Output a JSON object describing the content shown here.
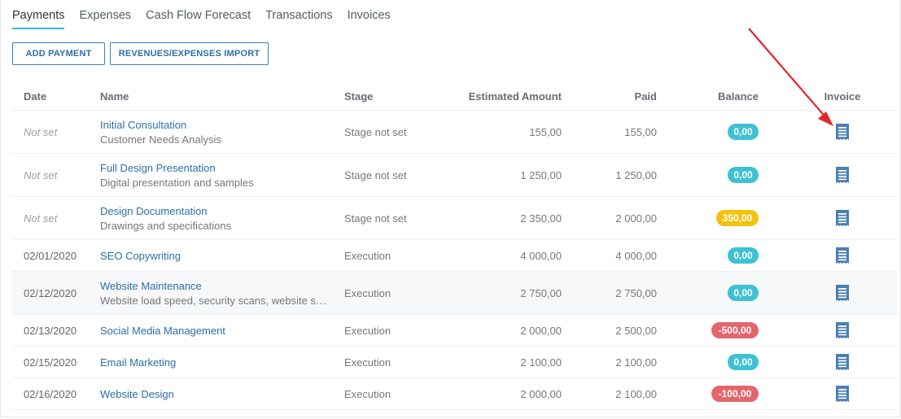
{
  "tabs": [
    {
      "label": "Payments",
      "active": true
    },
    {
      "label": "Expenses",
      "active": false
    },
    {
      "label": "Cash Flow Forecast",
      "active": false
    },
    {
      "label": "Transactions",
      "active": false
    },
    {
      "label": "Invoices",
      "active": false
    }
  ],
  "actions": {
    "add_payment": "ADD PAYMENT",
    "import": "REVENUES/EXPENSES IMPORT"
  },
  "table": {
    "headers": {
      "date": "Date",
      "name": "Name",
      "stage": "Stage",
      "estimated": "Estimated Amount",
      "paid": "Paid",
      "balance": "Balance",
      "invoice": "Invoice"
    },
    "rows": [
      {
        "date": "Not set",
        "name": "Initial Consultation",
        "desc": "Customer Needs Analysis",
        "stage": "Stage not set",
        "estimated": "155,00",
        "paid": "155,00",
        "balance": "0,00",
        "balance_color": "teal"
      },
      {
        "date": "Not set",
        "name": "Full Design Presentation",
        "desc": "Digital presentation and samples",
        "stage": "Stage not set",
        "estimated": "1 250,00",
        "paid": "1 250,00",
        "balance": "0,00",
        "balance_color": "teal"
      },
      {
        "date": "Not set",
        "name": "Design Documentation",
        "desc": "Drawings and specifications",
        "stage": "Stage not set",
        "estimated": "2 350,00",
        "paid": "2 000,00",
        "balance": "350,00",
        "balance_color": "yellow"
      },
      {
        "date": "02/01/2020",
        "name": "SEO Copywriting",
        "desc": "",
        "stage": "Execution",
        "estimated": "4 000,00",
        "paid": "4 000,00",
        "balance": "0,00",
        "balance_color": "teal"
      },
      {
        "date": "02/12/2020",
        "name": "Website Maintenance",
        "desc": "Website load speed, security scans, website s…",
        "stage": "Execution",
        "estimated": "2 750,00",
        "paid": "2 750,00",
        "balance": "0,00",
        "balance_color": "teal"
      },
      {
        "date": "02/13/2020",
        "name": "Social Media Management",
        "desc": "",
        "stage": "Execution",
        "estimated": "2 000,00",
        "paid": "2 500,00",
        "balance": "-500,00",
        "balance_color": "red"
      },
      {
        "date": "02/15/2020",
        "name": "Email Marketing",
        "desc": "",
        "stage": "Execution",
        "estimated": "2 100,00",
        "paid": "2 100,00",
        "balance": "0,00",
        "balance_color": "teal"
      },
      {
        "date": "02/16/2020",
        "name": "Website Design",
        "desc": "",
        "stage": "Execution",
        "estimated": "2 000,00",
        "paid": "2 100,00",
        "balance": "-100,00",
        "balance_color": "red"
      }
    ]
  },
  "colors": {
    "accent_tab": "#3ab7d8",
    "link": "#2a6fa8",
    "badge_teal": "#3ec1d3",
    "badge_yellow": "#f2c20f",
    "badge_red": "#e4656b",
    "invoice_icon": "#4a7fb5",
    "annotation_arrow": "#e3262b"
  },
  "icons": {
    "invoice": "invoice-document-icon",
    "annotation": "red-arrow-annotation"
  }
}
